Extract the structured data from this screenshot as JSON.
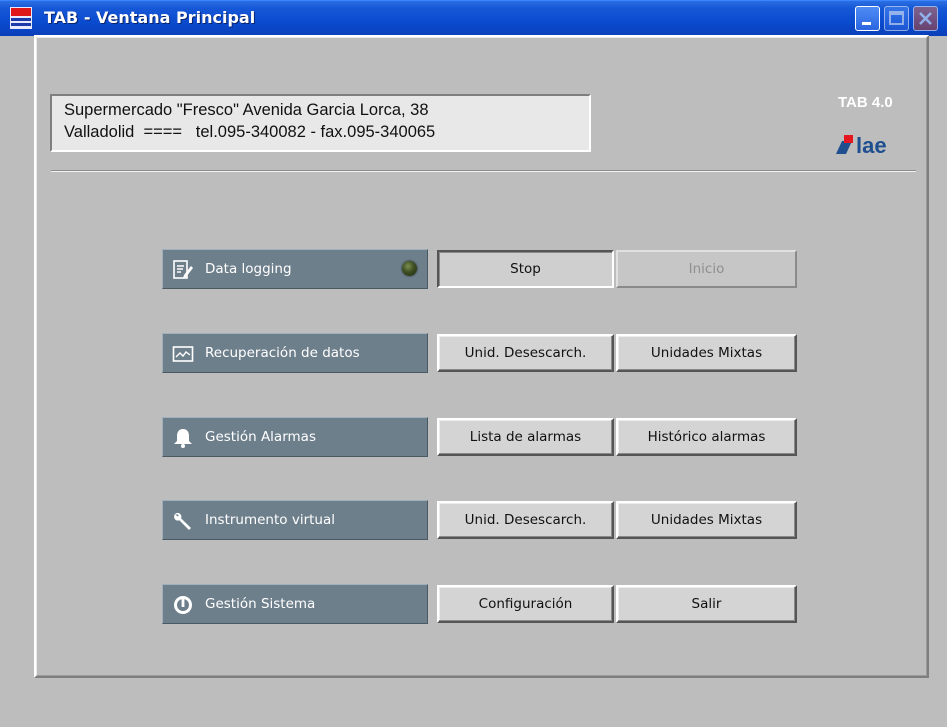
{
  "window": {
    "title": "TAB - Ventana Principal",
    "controls": [
      "minimize",
      "maximize",
      "close"
    ]
  },
  "header": {
    "address_line1": "Supermercado \"Fresco\" Avenida Garcia Lorca, 38",
    "address_line2": "Valladolid  ====   tel.095-340082 - fax.095-340065",
    "version": "TAB 4.0",
    "brand": "lae"
  },
  "rows": [
    {
      "label": "Data logging",
      "icon": "data-logging-icon",
      "led": "off",
      "left_button": "Stop",
      "right_button": "Inicio",
      "right_disabled": true
    },
    {
      "label": "Recuperación de datos",
      "icon": "chart-icon",
      "left_button": "Unid. Desescarch.",
      "right_button": "Unidades Mixtas"
    },
    {
      "label": "Gestión Alarmas",
      "icon": "bell-icon",
      "left_button": "Lista de alarmas",
      "right_button": "Histórico alarmas"
    },
    {
      "label": "Instrumento virtual",
      "icon": "wrench-icon",
      "left_button": "Unid. Desescarch.",
      "right_button": "Unidades Mixtas"
    },
    {
      "label": "Gestión Sistema",
      "icon": "power-icon",
      "left_button": "Configuración",
      "right_button": "Salir"
    }
  ],
  "colors": {
    "titlebar": "#0a4bd0",
    "label_bg": "#6e7f8c",
    "panel_bg": "#bdbdbd",
    "logo_red": "#e5161f",
    "logo_blue": "#1f4f8f"
  }
}
